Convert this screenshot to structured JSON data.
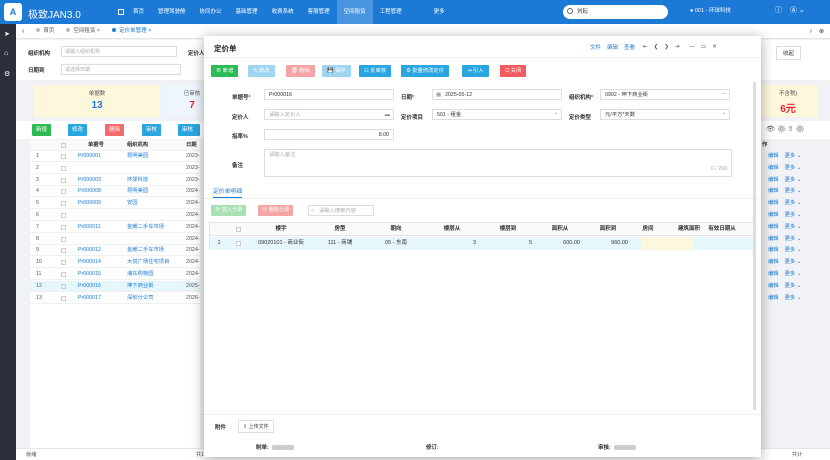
{
  "app": {
    "logo_letter": "A",
    "name": "极致JAN3.0"
  },
  "nav": {
    "items": [
      "首页",
      "管理驾驶舱",
      "协同办公",
      "基础管理",
      "收费系统",
      "客服管理",
      "空间租赁",
      "工程管理",
      "更多"
    ],
    "active_index": 6
  },
  "search": {
    "value": "刘耘"
  },
  "org": {
    "current": "001 - 环球科技"
  },
  "tabs": [
    {
      "label": "首页"
    },
    {
      "label": "空间租赁"
    },
    {
      "label": "定价单管理"
    }
  ],
  "bg": {
    "filters": {
      "org_label": "组织机构",
      "org_placeholder": "请输入组织机构",
      "date_label": "日期到",
      "date_placeholder": "请选择日期",
      "pricer_label": "定价人",
      "collapse": "收起"
    },
    "stats": [
      {
        "label": "单据数",
        "value": "13",
        "color": "#1c7ad6"
      },
      {
        "label": "已审核",
        "value": "7",
        "color": "#e23"
      },
      {
        "label": "不含税)",
        "value": "6元",
        "color": "#e23"
      }
    ],
    "toolbar": [
      {
        "label": "新增",
        "color": "#2dbb55"
      },
      {
        "label": "修改",
        "color": "#29a5e0"
      },
      {
        "label": "删除",
        "color": "#f26c6c"
      },
      {
        "label": "审核",
        "color": "#29a5e0"
      },
      {
        "label": "审核",
        "color": "#29a5e0"
      }
    ],
    "table_headers": [
      "单据号",
      "组织机构",
      "日期"
    ],
    "rows": [
      {
        "n": "1",
        "no": "Pr000001",
        "org": "昆明美园",
        "date": "2023-"
      },
      {
        "n": "2",
        "no": "",
        "org": "",
        "date": "2023-"
      },
      {
        "n": "3",
        "no": "Pr000003",
        "org": "环球科技",
        "date": "2023-"
      },
      {
        "n": "4",
        "no": "Pr000008",
        "org": "昆明美园",
        "date": "2024-"
      },
      {
        "n": "5",
        "no": "Pr000009",
        "org": "安园",
        "date": "2024-"
      },
      {
        "n": "6",
        "no": "",
        "org": "",
        "date": "2024-"
      },
      {
        "n": "7",
        "no": "Pr000011",
        "org": "金耀二手车市场",
        "date": "2024-"
      },
      {
        "n": "8",
        "no": "",
        "org": "",
        "date": "2024-"
      },
      {
        "n": "9",
        "no": "Pr000012",
        "org": "金耀二手车市场",
        "date": "2024-"
      },
      {
        "n": "10",
        "no": "Pr000014",
        "org": "大悦广场住宅项目",
        "date": "2024-"
      },
      {
        "n": "11",
        "no": "Pr000015",
        "org": "浦东购物园",
        "date": "2024-"
      },
      {
        "n": "12",
        "no": "Pr000016",
        "org": "坤下商业街",
        "date": "2025-"
      },
      {
        "n": "13",
        "no": "Pr000017",
        "org": "深圳分公司",
        "date": "2026-"
      }
    ],
    "right_col_header": "作",
    "right_links": [
      "编辑",
      "更多"
    ],
    "status_left": "就绪",
    "status_mid": "共13",
    "status_right": "共计"
  },
  "modal": {
    "title": "定价单",
    "tools": [
      "文件",
      "编辑",
      "查看"
    ],
    "nav_icons": [
      "⇤",
      "❮",
      "❯",
      "⇥"
    ],
    "win_icons": [
      "—",
      "▭",
      "✕"
    ],
    "actions": [
      {
        "label": "新增",
        "color": "#2dbb55",
        "enabled": true
      },
      {
        "label": "修改",
        "color": "#9fd5f0",
        "enabled": false
      },
      {
        "label": "删除",
        "color": "#f5a5a5",
        "enabled": false
      },
      {
        "label": "保存",
        "color": "#9fd5f0",
        "enabled": false
      },
      {
        "label": "反审核",
        "color": "#29a5e0",
        "enabled": true
      },
      {
        "label": "批量修改定价",
        "color": "#29a5e0",
        "enabled": true
      },
      {
        "label": "引入",
        "color": "#29a5e0",
        "enabled": true
      },
      {
        "label": "关闭",
        "color": "#f25c5c",
        "enabled": true
      }
    ],
    "form": {
      "doc_no": {
        "label": "单据号",
        "value": "Pr000016"
      },
      "date": {
        "label": "日期",
        "value": "2025-05-12"
      },
      "org": {
        "label": "组织机构",
        "value": "0902 - 坤下商业街"
      },
      "pricer": {
        "label": "定价人",
        "placeholder": "请输入定价人"
      },
      "pricing_item": {
        "label": "定价项目",
        "value": "501 - 租金"
      },
      "pricing_type": {
        "label": "定价类型",
        "value": "元/平方*天数"
      },
      "discount": {
        "label": "指率%",
        "value": "8.00"
      },
      "remark": {
        "label": "备注",
        "placeholder": "请输入备注",
        "counter": "0 / 200"
      }
    },
    "detail": {
      "section_title": "定价单明细",
      "buttons": [
        {
          "label": "插入分录"
        },
        {
          "label": "删除分录"
        }
      ],
      "search_placeholder": "请输入搜索内容",
      "headers": [
        "楼宇",
        "房型",
        "朝向",
        "楼层从",
        "楼层到",
        "面积从",
        "面积到",
        "房间",
        "建筑面积",
        "有效日期从"
      ],
      "row": {
        "n": "1",
        "building": "09020101 - 商业街",
        "room_type": "111 - 商铺",
        "orientation": "05 - 东南",
        "floor_from": "3",
        "floor_to": "5",
        "area_from": "600.00",
        "area_to": "960.00",
        "room": "",
        "build_area": "",
        "valid_from": ""
      }
    },
    "attach": {
      "label": "附件",
      "upload": "上传文件"
    },
    "footer": {
      "maker": "制单:",
      "modifier": "修订:",
      "auditor": "审核:"
    }
  }
}
